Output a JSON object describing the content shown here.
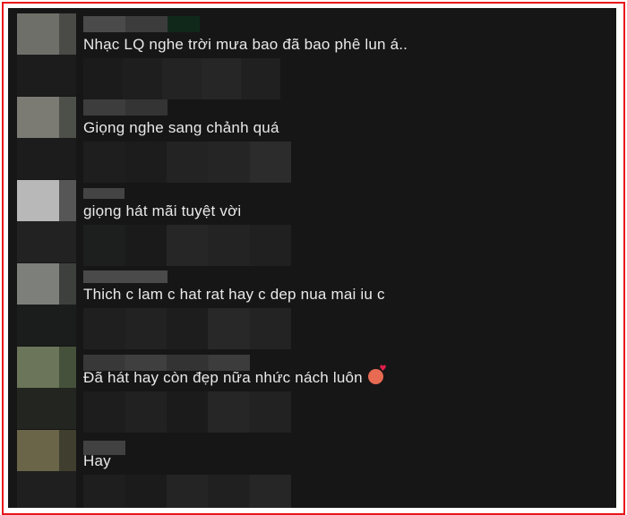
{
  "comments": [
    {
      "text": "Nhạc LQ nghe trời mưa bao đã bao phê lun á..",
      "avatar_color": "#6f6f6a"
    },
    {
      "text": "Giọng nghe sang chảnh quá",
      "avatar_color": "#7b7b74"
    },
    {
      "text": "giọng hát mãi tuyệt vời",
      "avatar_color": "#b8b8b8"
    },
    {
      "text": "Thich c lam c hat rat hay c dep nua mai iu c",
      "avatar_color": "#7d7f7b"
    },
    {
      "text": "Đã hát hay còn đẹp nữa nhức nách luôn",
      "avatar_color": "#6b7559",
      "emoji": "smiling-face-with-hearts-icon"
    },
    {
      "text": "Hay",
      "avatar_color": "#6a6548"
    }
  ]
}
